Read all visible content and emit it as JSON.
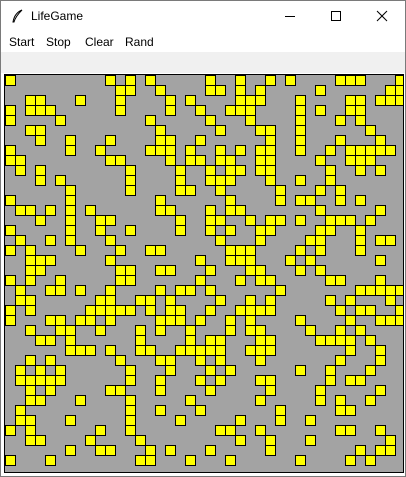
{
  "window": {
    "title": "LifeGame",
    "controls": [
      "minimize-icon",
      "maximize-icon",
      "close-icon"
    ]
  },
  "menu": {
    "items": [
      {
        "label": "Start"
      },
      {
        "label": "Stop"
      },
      {
        "label": "Clear"
      },
      {
        "label": "Rand"
      }
    ]
  },
  "colors": {
    "cell_alive": "#ffff00",
    "cell_border": "#000000",
    "board_background": "#a3a3a3"
  },
  "board": {
    "alive_cells": [
      [
        0,
        0
      ],
      [
        10,
        0
      ],
      [
        12,
        0
      ],
      [
        14,
        0
      ],
      [
        20,
        0
      ],
      [
        23,
        0
      ],
      [
        26,
        0
      ],
      [
        28,
        0
      ],
      [
        33,
        0
      ],
      [
        34,
        0
      ],
      [
        35,
        0
      ],
      [
        39,
        0
      ],
      [
        11,
        1
      ],
      [
        12,
        1
      ],
      [
        15,
        1
      ],
      [
        20,
        1
      ],
      [
        21,
        1
      ],
      [
        23,
        1
      ],
      [
        25,
        1
      ],
      [
        31,
        1
      ],
      [
        38,
        1
      ],
      [
        39,
        1
      ],
      [
        2,
        2
      ],
      [
        3,
        2
      ],
      [
        7,
        2
      ],
      [
        11,
        2
      ],
      [
        16,
        2
      ],
      [
        18,
        2
      ],
      [
        23,
        2
      ],
      [
        24,
        2
      ],
      [
        25,
        2
      ],
      [
        29,
        2
      ],
      [
        34,
        2
      ],
      [
        35,
        2
      ],
      [
        37,
        2
      ],
      [
        38,
        2
      ],
      [
        39,
        2
      ],
      [
        0,
        3
      ],
      [
        2,
        3
      ],
      [
        3,
        3
      ],
      [
        4,
        3
      ],
      [
        11,
        3
      ],
      [
        16,
        3
      ],
      [
        19,
        3
      ],
      [
        22,
        3
      ],
      [
        23,
        3
      ],
      [
        24,
        3
      ],
      [
        29,
        3
      ],
      [
        31,
        3
      ],
      [
        34,
        3
      ],
      [
        35,
        3
      ],
      [
        0,
        4
      ],
      [
        5,
        4
      ],
      [
        14,
        4
      ],
      [
        20,
        4
      ],
      [
        24,
        4
      ],
      [
        29,
        4
      ],
      [
        33,
        4
      ],
      [
        35,
        4
      ],
      [
        2,
        5
      ],
      [
        3,
        5
      ],
      [
        15,
        5
      ],
      [
        21,
        5
      ],
      [
        25,
        5
      ],
      [
        26,
        5
      ],
      [
        29,
        5
      ],
      [
        36,
        5
      ],
      [
        3,
        6
      ],
      [
        6,
        6
      ],
      [
        10,
        6
      ],
      [
        15,
        6
      ],
      [
        16,
        6
      ],
      [
        19,
        6
      ],
      [
        26,
        6
      ],
      [
        29,
        6
      ],
      [
        33,
        6
      ],
      [
        37,
        6
      ],
      [
        0,
        7
      ],
      [
        6,
        7
      ],
      [
        9,
        7
      ],
      [
        14,
        7
      ],
      [
        15,
        7
      ],
      [
        16,
        7
      ],
      [
        18,
        7
      ],
      [
        21,
        7
      ],
      [
        23,
        7
      ],
      [
        25,
        7
      ],
      [
        26,
        7
      ],
      [
        29,
        7
      ],
      [
        32,
        7
      ],
      [
        34,
        7
      ],
      [
        35,
        7
      ],
      [
        36,
        7
      ],
      [
        37,
        7
      ],
      [
        38,
        7
      ],
      [
        0,
        8
      ],
      [
        1,
        8
      ],
      [
        10,
        8
      ],
      [
        11,
        8
      ],
      [
        16,
        8
      ],
      [
        18,
        8
      ],
      [
        19,
        8
      ],
      [
        21,
        8
      ],
      [
        22,
        8
      ],
      [
        25,
        8
      ],
      [
        26,
        8
      ],
      [
        31,
        8
      ],
      [
        34,
        8
      ],
      [
        35,
        8
      ],
      [
        36,
        8
      ],
      [
        1,
        9
      ],
      [
        3,
        9
      ],
      [
        12,
        9
      ],
      [
        17,
        9
      ],
      [
        20,
        9
      ],
      [
        22,
        9
      ],
      [
        23,
        9
      ],
      [
        25,
        9
      ],
      [
        26,
        9
      ],
      [
        32,
        9
      ],
      [
        35,
        9
      ],
      [
        37,
        9
      ],
      [
        3,
        10
      ],
      [
        5,
        10
      ],
      [
        12,
        10
      ],
      [
        17,
        10
      ],
      [
        20,
        10
      ],
      [
        21,
        10
      ],
      [
        22,
        10
      ],
      [
        26,
        10
      ],
      [
        29,
        10
      ],
      [
        32,
        10
      ],
      [
        6,
        11
      ],
      [
        12,
        11
      ],
      [
        17,
        11
      ],
      [
        18,
        11
      ],
      [
        21,
        11
      ],
      [
        27,
        11
      ],
      [
        31,
        11
      ],
      [
        33,
        11
      ],
      [
        0,
        12
      ],
      [
        6,
        12
      ],
      [
        15,
        12
      ],
      [
        22,
        12
      ],
      [
        27,
        12
      ],
      [
        29,
        12
      ],
      [
        30,
        12
      ],
      [
        33,
        12
      ],
      [
        35,
        12
      ],
      [
        1,
        13
      ],
      [
        2,
        13
      ],
      [
        4,
        13
      ],
      [
        6,
        13
      ],
      [
        8,
        13
      ],
      [
        15,
        13
      ],
      [
        16,
        13
      ],
      [
        20,
        13
      ],
      [
        22,
        13
      ],
      [
        23,
        13
      ],
      [
        31,
        13
      ],
      [
        37,
        13
      ],
      [
        3,
        14
      ],
      [
        6,
        14
      ],
      [
        9,
        14
      ],
      [
        10,
        14
      ],
      [
        17,
        14
      ],
      [
        20,
        14
      ],
      [
        21,
        14
      ],
      [
        24,
        14
      ],
      [
        26,
        14
      ],
      [
        27,
        14
      ],
      [
        29,
        14
      ],
      [
        32,
        14
      ],
      [
        33,
        14
      ],
      [
        34,
        14
      ],
      [
        36,
        14
      ],
      [
        0,
        15
      ],
      [
        6,
        15
      ],
      [
        9,
        15
      ],
      [
        12,
        15
      ],
      [
        17,
        15
      ],
      [
        20,
        15
      ],
      [
        22,
        15
      ],
      [
        25,
        15
      ],
      [
        26,
        15
      ],
      [
        31,
        15
      ],
      [
        32,
        15
      ],
      [
        35,
        15
      ],
      [
        1,
        16
      ],
      [
        4,
        16
      ],
      [
        6,
        16
      ],
      [
        10,
        16
      ],
      [
        21,
        16
      ],
      [
        25,
        16
      ],
      [
        30,
        16
      ],
      [
        31,
        16
      ],
      [
        35,
        16
      ],
      [
        37,
        16
      ],
      [
        38,
        16
      ],
      [
        0,
        17
      ],
      [
        2,
        17
      ],
      [
        7,
        17
      ],
      [
        11,
        17
      ],
      [
        14,
        17
      ],
      [
        15,
        17
      ],
      [
        22,
        17
      ],
      [
        23,
        17
      ],
      [
        24,
        17
      ],
      [
        29,
        17
      ],
      [
        31,
        17
      ],
      [
        35,
        17
      ],
      [
        2,
        18
      ],
      [
        3,
        18
      ],
      [
        4,
        18
      ],
      [
        10,
        18
      ],
      [
        19,
        18
      ],
      [
        22,
        18
      ],
      [
        23,
        18
      ],
      [
        24,
        18
      ],
      [
        28,
        18
      ],
      [
        30,
        18
      ],
      [
        37,
        18
      ],
      [
        2,
        19
      ],
      [
        3,
        19
      ],
      [
        11,
        19
      ],
      [
        12,
        19
      ],
      [
        15,
        19
      ],
      [
        16,
        19
      ],
      [
        20,
        19
      ],
      [
        24,
        19
      ],
      [
        25,
        19
      ],
      [
        29,
        19
      ],
      [
        31,
        19
      ],
      [
        0,
        20
      ],
      [
        2,
        20
      ],
      [
        5,
        20
      ],
      [
        11,
        20
      ],
      [
        12,
        20
      ],
      [
        19,
        20
      ],
      [
        23,
        20
      ],
      [
        25,
        20
      ],
      [
        26,
        20
      ],
      [
        32,
        20
      ],
      [
        33,
        20
      ],
      [
        37,
        20
      ],
      [
        1,
        21
      ],
      [
        4,
        21
      ],
      [
        5,
        21
      ],
      [
        7,
        21
      ],
      [
        10,
        21
      ],
      [
        15,
        21
      ],
      [
        17,
        21
      ],
      [
        18,
        21
      ],
      [
        20,
        21
      ],
      [
        27,
        21
      ],
      [
        35,
        21
      ],
      [
        36,
        21
      ],
      [
        37,
        21
      ],
      [
        38,
        21
      ],
      [
        39,
        21
      ],
      [
        1,
        22
      ],
      [
        2,
        22
      ],
      [
        9,
        22
      ],
      [
        10,
        22
      ],
      [
        13,
        22
      ],
      [
        14,
        22
      ],
      [
        16,
        22
      ],
      [
        21,
        22
      ],
      [
        24,
        22
      ],
      [
        26,
        22
      ],
      [
        32,
        22
      ],
      [
        34,
        22
      ],
      [
        38,
        22
      ],
      [
        0,
        23
      ],
      [
        2,
        23
      ],
      [
        8,
        23
      ],
      [
        9,
        23
      ],
      [
        10,
        23
      ],
      [
        11,
        23
      ],
      [
        12,
        23
      ],
      [
        14,
        23
      ],
      [
        16,
        23
      ],
      [
        17,
        23
      ],
      [
        20,
        23
      ],
      [
        23,
        23
      ],
      [
        24,
        23
      ],
      [
        25,
        23
      ],
      [
        26,
        23
      ],
      [
        33,
        23
      ],
      [
        35,
        23
      ],
      [
        36,
        23
      ],
      [
        39,
        23
      ],
      [
        0,
        24
      ],
      [
        4,
        24
      ],
      [
        5,
        24
      ],
      [
        7,
        24
      ],
      [
        8,
        24
      ],
      [
        10,
        24
      ],
      [
        15,
        24
      ],
      [
        16,
        24
      ],
      [
        17,
        24
      ],
      [
        19,
        24
      ],
      [
        22,
        24
      ],
      [
        24,
        24
      ],
      [
        29,
        24
      ],
      [
        34,
        24
      ],
      [
        37,
        24
      ],
      [
        38,
        24
      ],
      [
        39,
        24
      ],
      [
        2,
        25
      ],
      [
        5,
        25
      ],
      [
        6,
        25
      ],
      [
        9,
        25
      ],
      [
        13,
        25
      ],
      [
        15,
        25
      ],
      [
        18,
        25
      ],
      [
        22,
        25
      ],
      [
        24,
        25
      ],
      [
        25,
        25
      ],
      [
        30,
        25
      ],
      [
        33,
        25
      ],
      [
        35,
        25
      ],
      [
        3,
        26
      ],
      [
        4,
        26
      ],
      [
        6,
        26
      ],
      [
        13,
        26
      ],
      [
        18,
        26
      ],
      [
        20,
        26
      ],
      [
        21,
        26
      ],
      [
        25,
        26
      ],
      [
        26,
        26
      ],
      [
        31,
        26
      ],
      [
        32,
        26
      ],
      [
        33,
        26
      ],
      [
        34,
        26
      ],
      [
        36,
        26
      ],
      [
        6,
        27
      ],
      [
        7,
        27
      ],
      [
        8,
        27
      ],
      [
        10,
        27
      ],
      [
        13,
        27
      ],
      [
        14,
        27
      ],
      [
        17,
        27
      ],
      [
        18,
        27
      ],
      [
        19,
        27
      ],
      [
        20,
        27
      ],
      [
        21,
        27
      ],
      [
        24,
        27
      ],
      [
        25,
        27
      ],
      [
        26,
        27
      ],
      [
        34,
        27
      ],
      [
        37,
        27
      ],
      [
        2,
        28
      ],
      [
        4,
        28
      ],
      [
        11,
        28
      ],
      [
        15,
        28
      ],
      [
        16,
        28
      ],
      [
        19,
        28
      ],
      [
        21,
        28
      ],
      [
        25,
        28
      ],
      [
        33,
        28
      ],
      [
        37,
        28
      ],
      [
        1,
        29
      ],
      [
        3,
        29
      ],
      [
        5,
        29
      ],
      [
        12,
        29
      ],
      [
        16,
        29
      ],
      [
        20,
        29
      ],
      [
        22,
        29
      ],
      [
        29,
        29
      ],
      [
        32,
        29
      ],
      [
        36,
        29
      ],
      [
        1,
        30
      ],
      [
        2,
        30
      ],
      [
        3,
        30
      ],
      [
        4,
        30
      ],
      [
        5,
        30
      ],
      [
        12,
        30
      ],
      [
        15,
        30
      ],
      [
        19,
        30
      ],
      [
        21,
        30
      ],
      [
        25,
        30
      ],
      [
        26,
        30
      ],
      [
        32,
        30
      ],
      [
        34,
        30
      ],
      [
        35,
        30
      ],
      [
        2,
        31
      ],
      [
        4,
        31
      ],
      [
        10,
        31
      ],
      [
        11,
        31
      ],
      [
        15,
        31
      ],
      [
        20,
        31
      ],
      [
        26,
        31
      ],
      [
        31,
        31
      ],
      [
        37,
        31
      ],
      [
        2,
        32
      ],
      [
        3,
        32
      ],
      [
        7,
        32
      ],
      [
        12,
        32
      ],
      [
        18,
        32
      ],
      [
        25,
        32
      ],
      [
        31,
        32
      ],
      [
        33,
        32
      ],
      [
        36,
        32
      ],
      [
        1,
        33
      ],
      [
        12,
        33
      ],
      [
        15,
        33
      ],
      [
        19,
        33
      ],
      [
        27,
        33
      ],
      [
        33,
        33
      ],
      [
        34,
        33
      ],
      [
        1,
        34
      ],
      [
        2,
        34
      ],
      [
        6,
        34
      ],
      [
        12,
        34
      ],
      [
        17,
        34
      ],
      [
        23,
        34
      ],
      [
        27,
        34
      ],
      [
        30,
        34
      ],
      [
        0,
        35
      ],
      [
        2,
        35
      ],
      [
        9,
        35
      ],
      [
        12,
        35
      ],
      [
        21,
        35
      ],
      [
        22,
        35
      ],
      [
        25,
        35
      ],
      [
        33,
        35
      ],
      [
        34,
        35
      ],
      [
        37,
        35
      ],
      [
        2,
        36
      ],
      [
        3,
        36
      ],
      [
        8,
        36
      ],
      [
        13,
        36
      ],
      [
        23,
        36
      ],
      [
        26,
        36
      ],
      [
        30,
        36
      ],
      [
        38,
        36
      ],
      [
        6,
        37
      ],
      [
        9,
        37
      ],
      [
        10,
        37
      ],
      [
        14,
        37
      ],
      [
        16,
        37
      ],
      [
        20,
        37
      ],
      [
        26,
        37
      ],
      [
        35,
        37
      ],
      [
        37,
        37
      ],
      [
        38,
        37
      ],
      [
        0,
        38
      ],
      [
        4,
        38
      ],
      [
        13,
        38
      ],
      [
        14,
        38
      ],
      [
        18,
        38
      ],
      [
        22,
        38
      ],
      [
        29,
        38
      ],
      [
        34,
        38
      ],
      [
        36,
        38
      ]
    ]
  }
}
